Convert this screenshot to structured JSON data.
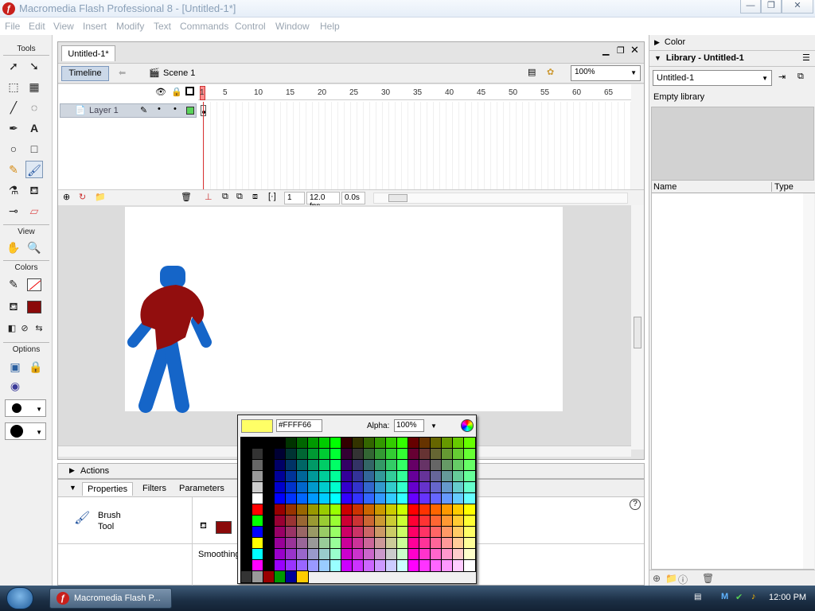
{
  "window": {
    "title": "Macromedia Flash Professional 8 - [Untitled-1*]"
  },
  "menu": {
    "items": [
      "File",
      "Edit",
      "View",
      "Insert",
      "Modify",
      "Text",
      "Commands",
      "Control",
      "Window",
      "Help"
    ]
  },
  "tools": {
    "sections": {
      "tools": "Tools",
      "view": "View",
      "colors": "Colors",
      "options": "Options"
    },
    "stroke_color": "#ffffff",
    "fill_color": "#8b0a0a"
  },
  "document": {
    "tab": "Untitled-1*",
    "timeline_button": "Timeline",
    "scene": "Scene 1",
    "zoom": "100%"
  },
  "timeline": {
    "layer_name": "Layer 1",
    "ruler_ticks": [
      "1",
      "5",
      "10",
      "15",
      "20",
      "25",
      "30",
      "35",
      "40",
      "45",
      "50",
      "55",
      "60",
      "65"
    ],
    "current_frame": "1",
    "fps": "12.0 fps",
    "elapsed": "0.0s"
  },
  "panels": {
    "actions": "Actions",
    "properties_tabs": [
      "Properties",
      "Filters",
      "Parameters"
    ],
    "tool_name": "Brush Tool",
    "smoothing_label": "Smoothing"
  },
  "swatches": {
    "hex": "#FFFF66",
    "alpha_label": "Alpha:",
    "alpha_value": "100%",
    "preview_color": "#ffff66"
  },
  "right": {
    "color_panel": "Color",
    "library_panel": "Library - Untitled-1",
    "library_select": "Untitled-1",
    "empty_text": "Empty library",
    "col_name": "Name",
    "col_type": "Type"
  },
  "taskbar": {
    "app": "Macromedia Flash P...",
    "clock": "12:00 PM"
  }
}
